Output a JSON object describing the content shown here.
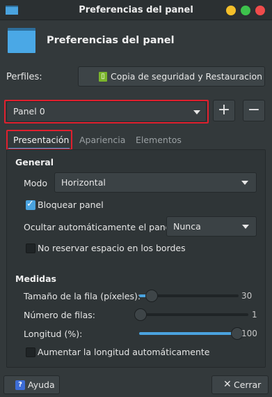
{
  "window": {
    "title": "Preferencias del panel",
    "buttons": {
      "minimize_color": "#f4bf2a",
      "maximize_color": "#3dc24c",
      "close_color": "#ef4b4b"
    }
  },
  "header": {
    "title": "Preferencias del panel",
    "icon": "panel-icon"
  },
  "profiles": {
    "label": "Perfiles:",
    "button_label": "Copia de seguridad y Restauracion"
  },
  "panel_selector": {
    "value": "Panel 0",
    "add_label": "+",
    "remove_label": "−"
  },
  "tabs": [
    {
      "label": "Presentación",
      "active": true
    },
    {
      "label": "Apariencia",
      "active": false
    },
    {
      "label": "Elementos",
      "active": false
    }
  ],
  "general": {
    "title": "General",
    "mode_label": "Modo",
    "mode_value": "Horizontal",
    "lock_label": "Bloquear panel",
    "lock_checked": true,
    "autohide_label": "Ocultar automáticamente el panel:",
    "autohide_value": "Nunca",
    "no_reserve_label": "No reservar espacio en los bordes",
    "no_reserve_checked": false
  },
  "measures": {
    "title": "Medidas",
    "row_size": {
      "label": "Tamaño de la fila (píxeles):",
      "value": "30",
      "fraction": 0.1
    },
    "rows": {
      "label": "Número de filas:",
      "value": "1",
      "fraction": 0.0
    },
    "length": {
      "label": "Longitud (%):",
      "value": "100",
      "fraction": 1.0
    },
    "autolength_label": "Aumentar la longitud automáticamente",
    "autolength_checked": false
  },
  "footer": {
    "help_label": "Ayuda",
    "close_label": "Cerrar"
  },
  "colors": {
    "accent": "#4aa3df",
    "highlight": "#e0202e",
    "background": "#33393b"
  }
}
